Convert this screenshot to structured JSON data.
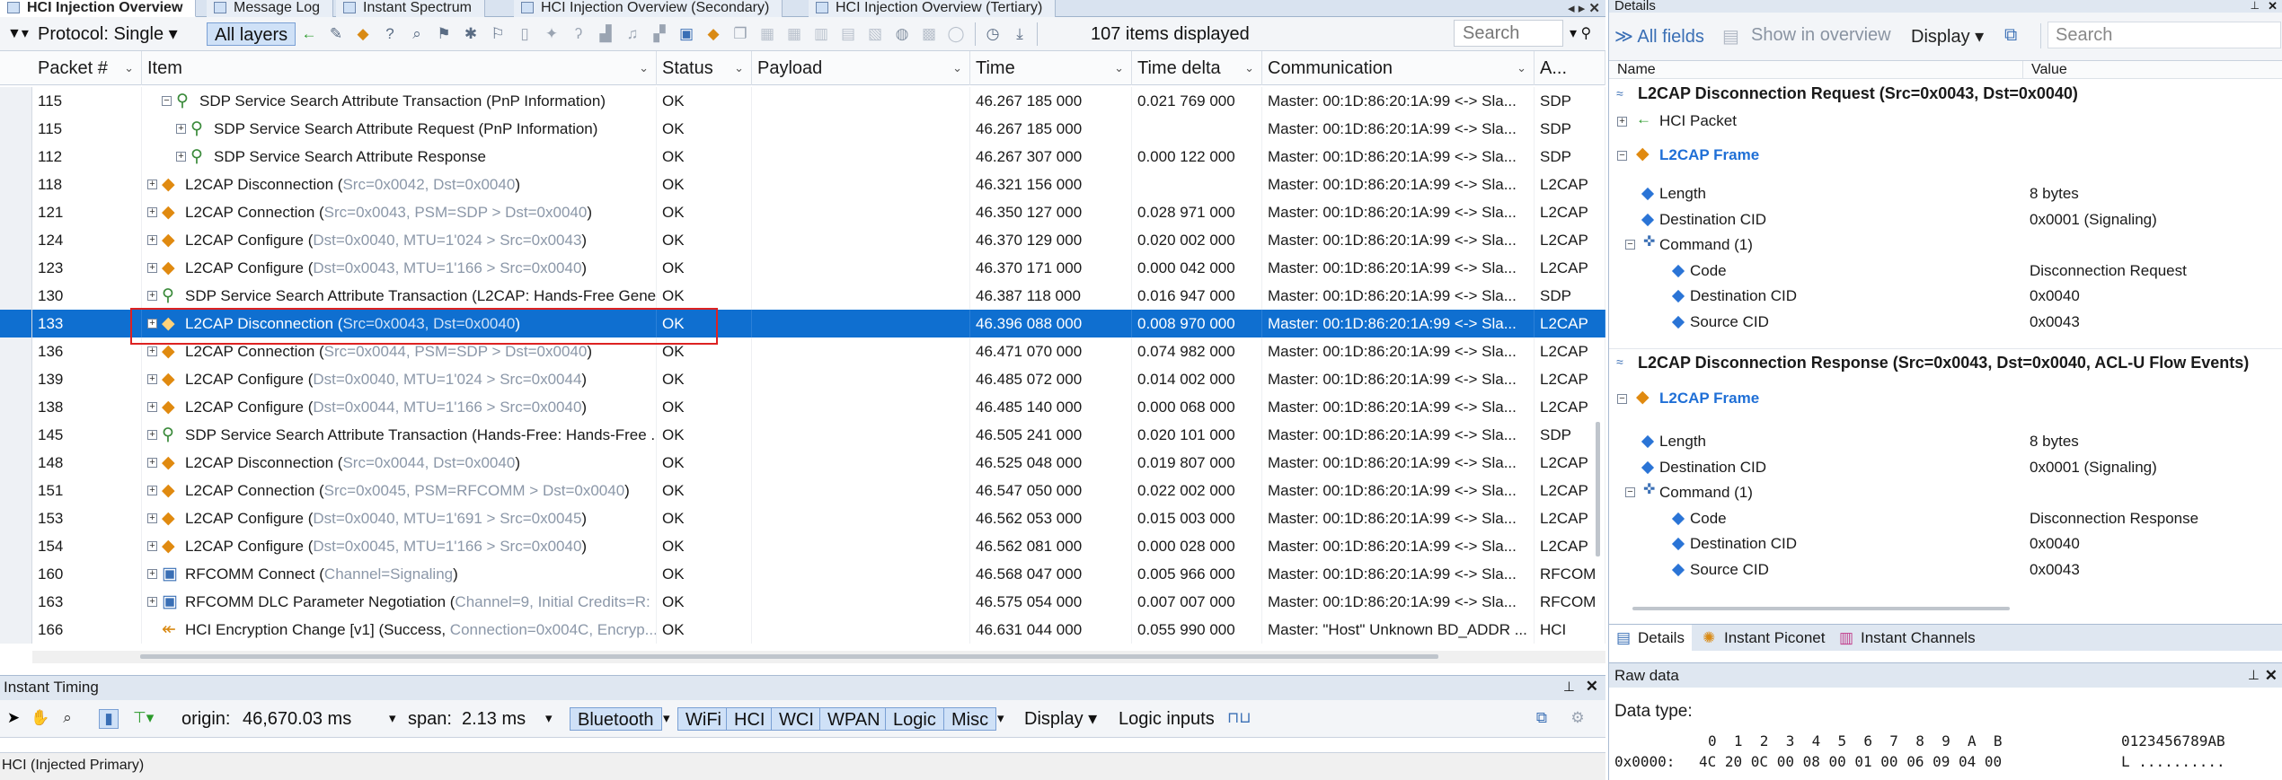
{
  "tabs": [
    {
      "label": "HCI Injection Overview",
      "active": true
    },
    {
      "label": "Message Log",
      "active": false
    },
    {
      "label": "Instant Spectrum",
      "active": false
    },
    {
      "label": "HCI Injection Overview (Secondary)",
      "active": false
    },
    {
      "label": "HCI Injection Overview (Tertiary)",
      "active": false
    }
  ],
  "toolbar": {
    "protocol_label": "Protocol: Single",
    "all_layers": "All layers",
    "items_count": "107 items displayed",
    "search_placeholder": "Search"
  },
  "columns": [
    "Packet #",
    "Item",
    "Status",
    "Payload",
    "Time",
    "Time delta",
    "Communication",
    "A..."
  ],
  "rows": [
    {
      "packet": "115",
      "indent": 1,
      "expand": "−",
      "icon": "sdp",
      "text": "SDP Service Search Attribute Transaction (PnP Information)",
      "status": "OK",
      "time": "46.267 185 000",
      "delta": "0.021 769 000",
      "comm": "Master: 00:1D:86:20:1A:99 <-> Sla...",
      "proto": "SDP"
    },
    {
      "packet": "115",
      "indent": 2,
      "expand": "+",
      "icon": "sdp",
      "text": "SDP Service Search Attribute Request (PnP Information)",
      "status": "OK",
      "time": "46.267 185 000",
      "delta": "",
      "comm": "Master: 00:1D:86:20:1A:99 <-> Sla...",
      "proto": "SDP"
    },
    {
      "packet": "112",
      "indent": 2,
      "expand": "+",
      "icon": "sdp",
      "text": "SDP Service Search Attribute Response",
      "status": "OK",
      "time": "46.267 307 000",
      "delta": "0.000 122 000",
      "comm": "Master: 00:1D:86:20:1A:99 <-> Sla...",
      "proto": "SDP"
    },
    {
      "packet": "118",
      "indent": 0,
      "expand": "+",
      "icon": "l2cap",
      "text": "L2CAP Disconnection (",
      "params": "Src=0x0042, Dst=0x0040",
      "tail": ")",
      "status": "OK",
      "time": "46.321 156 000",
      "delta": "",
      "comm": "Master: 00:1D:86:20:1A:99 <-> Sla...",
      "proto": "L2CAP"
    },
    {
      "packet": "121",
      "indent": 0,
      "expand": "+",
      "icon": "l2cap",
      "text": "L2CAP Connection (",
      "params": "Src=0x0043, PSM=SDP > Dst=0x0040",
      "tail": ")",
      "status": "OK",
      "time": "46.350 127 000",
      "delta": "0.028 971 000",
      "comm": "Master: 00:1D:86:20:1A:99 <-> Sla...",
      "proto": "L2CAP"
    },
    {
      "packet": "124",
      "indent": 0,
      "expand": "+",
      "icon": "l2cap",
      "text": "L2CAP Configure (",
      "params": "Dst=0x0040, MTU=1'024 > Src=0x0043",
      "tail": ")",
      "status": "OK",
      "time": "46.370 129 000",
      "delta": "0.020 002 000",
      "comm": "Master: 00:1D:86:20:1A:99 <-> Sla...",
      "proto": "L2CAP"
    },
    {
      "packet": "123",
      "indent": 0,
      "expand": "+",
      "icon": "l2cap",
      "text": "L2CAP Configure (",
      "params": "Dst=0x0043, MTU=1'166 > Src=0x0040",
      "tail": ")",
      "status": "OK",
      "time": "46.370 171 000",
      "delta": "0.000 042 000",
      "comm": "Master: 00:1D:86:20:1A:99 <-> Sla...",
      "proto": "L2CAP"
    },
    {
      "packet": "130",
      "indent": 0,
      "expand": "+",
      "icon": "sdp",
      "text": "SDP Service Search Attribute Transaction (L2CAP: Hands-Free Gene...",
      "status": "OK",
      "time": "46.387 118 000",
      "delta": "0.016 947 000",
      "comm": "Master: 00:1D:86:20:1A:99 <-> Sla...",
      "proto": "SDP"
    },
    {
      "packet": "133",
      "indent": 0,
      "expand": "+",
      "icon": "l2cap",
      "text": "L2CAP Disconnection (",
      "params": "Src=0x0043, Dst=0x0040",
      "tail": ")",
      "status": "OK",
      "time": "46.396 088 000",
      "delta": "0.008 970 000",
      "comm": "Master: 00:1D:86:20:1A:99 <-> Sla...",
      "proto": "L2CAP",
      "selected": true
    },
    {
      "packet": "136",
      "indent": 0,
      "expand": "+",
      "icon": "l2cap",
      "text": "L2CAP Connection (",
      "params": "Src=0x0044, PSM=SDP > Dst=0x0040",
      "tail": ")",
      "status": "OK",
      "time": "46.471 070 000",
      "delta": "0.074 982 000",
      "comm": "Master: 00:1D:86:20:1A:99 <-> Sla...",
      "proto": "L2CAP"
    },
    {
      "packet": "139",
      "indent": 0,
      "expand": "+",
      "icon": "l2cap",
      "text": "L2CAP Configure (",
      "params": "Dst=0x0040, MTU=1'024 > Src=0x0044",
      "tail": ")",
      "status": "OK",
      "time": "46.485 072 000",
      "delta": "0.014 002 000",
      "comm": "Master: 00:1D:86:20:1A:99 <-> Sla...",
      "proto": "L2CAP"
    },
    {
      "packet": "138",
      "indent": 0,
      "expand": "+",
      "icon": "l2cap",
      "text": "L2CAP Configure (",
      "params": "Dst=0x0044, MTU=1'166 > Src=0x0040",
      "tail": ")",
      "status": "OK",
      "time": "46.485 140 000",
      "delta": "0.000 068 000",
      "comm": "Master: 00:1D:86:20:1A:99 <-> Sla...",
      "proto": "L2CAP"
    },
    {
      "packet": "145",
      "indent": 0,
      "expand": "+",
      "icon": "sdp",
      "text": "SDP Service Search Attribute Transaction (Hands-Free: Hands-Free ...",
      "status": "OK",
      "time": "46.505 241 000",
      "delta": "0.020 101 000",
      "comm": "Master: 00:1D:86:20:1A:99 <-> Sla...",
      "proto": "SDP"
    },
    {
      "packet": "148",
      "indent": 0,
      "expand": "+",
      "icon": "l2cap",
      "text": "L2CAP Disconnection (",
      "params": "Src=0x0044, Dst=0x0040",
      "tail": ")",
      "status": "OK",
      "time": "46.525 048 000",
      "delta": "0.019 807 000",
      "comm": "Master: 00:1D:86:20:1A:99 <-> Sla...",
      "proto": "L2CAP"
    },
    {
      "packet": "151",
      "indent": 0,
      "expand": "+",
      "icon": "l2cap",
      "text": "L2CAP Connection (",
      "params": "Src=0x0045, PSM=RFCOMM > Dst=0x0040",
      "tail": ")",
      "status": "OK",
      "time": "46.547 050 000",
      "delta": "0.022 002 000",
      "comm": "Master: 00:1D:86:20:1A:99 <-> Sla...",
      "proto": "L2CAP"
    },
    {
      "packet": "153",
      "indent": 0,
      "expand": "+",
      "icon": "l2cap",
      "text": "L2CAP Configure (",
      "params": "Dst=0x0040, MTU=1'691 > Src=0x0045",
      "tail": ")",
      "status": "OK",
      "time": "46.562 053 000",
      "delta": "0.015 003 000",
      "comm": "Master: 00:1D:86:20:1A:99 <-> Sla...",
      "proto": "L2CAP"
    },
    {
      "packet": "154",
      "indent": 0,
      "expand": "+",
      "icon": "l2cap",
      "text": "L2CAP Configure (",
      "params": "Dst=0x0045, MTU=1'166 > Src=0x0040",
      "tail": ")",
      "status": "OK",
      "time": "46.562 081 000",
      "delta": "0.000 028 000",
      "comm": "Master: 00:1D:86:20:1A:99 <-> Sla...",
      "proto": "L2CAP"
    },
    {
      "packet": "160",
      "indent": 0,
      "expand": "+",
      "icon": "rfcomm",
      "text": "RFCOMM Connect (",
      "params": "Channel=Signaling",
      "tail": ")",
      "status": "OK",
      "time": "46.568 047 000",
      "delta": "0.005 966 000",
      "comm": "Master: 00:1D:86:20:1A:99 <-> Sla...",
      "proto": "RFCOM"
    },
    {
      "packet": "163",
      "indent": 0,
      "expand": "+",
      "icon": "rfcomm",
      "text": "RFCOMM DLC Parameter Negotiation (",
      "params": "Channel=9, Initial Credits=R: ...",
      "tail": "",
      "status": "OK",
      "time": "46.575 054 000",
      "delta": "0.007 007 000",
      "comm": "Master: 00:1D:86:20:1A:99 <-> Sla...",
      "proto": "RFCOM"
    },
    {
      "packet": "166",
      "indent": 0,
      "expand": "",
      "icon": "hci",
      "text": "HCI Encryption Change [v1] (Success, ",
      "params": "Connection=0x004C, Encryp...",
      "tail": "",
      "status": "OK",
      "time": "46.631 044 000",
      "delta": "0.055 990 000",
      "comm": "Master: \"Host\" Unknown BD_ADDR ...",
      "proto": "HCI"
    }
  ],
  "timing": {
    "title": "Instant Timing",
    "origin_label": "origin:",
    "origin_value": "46,670.03 ms",
    "span_label": "span:",
    "span_value": "2.13 ms",
    "filters": [
      "Bluetooth",
      "WiFi",
      "HCI",
      "WCI",
      "WPAN",
      "Logic",
      "Misc"
    ],
    "display": "Display",
    "logic_inputs": "Logic inputs"
  },
  "status_bar": "HCI (Injected Primary)",
  "details": {
    "title": "Details",
    "all_fields": "All fields",
    "show_in_overview": "Show in overview",
    "display": "Display",
    "search_placeholder": "Search",
    "col_name": "Name",
    "col_value": "Value",
    "section1_title": "L2CAP Disconnection Request (Src=0x0043, Dst=0x0040)",
    "hci_packet": "HCI Packet",
    "frame_label": "L2CAP Frame",
    "s1_fields": [
      {
        "name": "Length",
        "value": "8 bytes",
        "level": 1
      },
      {
        "name": "Destination CID",
        "value": "0x0001 (Signaling)",
        "level": 1
      },
      {
        "name": "Command (1)",
        "value": "",
        "level": 1,
        "group": true
      },
      {
        "name": "Code",
        "value": "Disconnection Request",
        "level": 2
      },
      {
        "name": "Destination CID",
        "value": "0x0040",
        "level": 2
      },
      {
        "name": "Source CID",
        "value": "0x0043",
        "level": 2
      }
    ],
    "section2_title": "L2CAP Disconnection Response (Src=0x0043, Dst=0x0040, ACL-U Flow Events)",
    "s2_fields": [
      {
        "name": "Length",
        "value": "8 bytes",
        "level": 1
      },
      {
        "name": "Destination CID",
        "value": "0x0001 (Signaling)",
        "level": 1
      },
      {
        "name": "Command (1)",
        "value": "",
        "level": 1,
        "group": true
      },
      {
        "name": "Code",
        "value": "Disconnection Response",
        "level": 2
      },
      {
        "name": "Destination CID",
        "value": "0x0040",
        "level": 2
      },
      {
        "name": "Source CID",
        "value": "0x0043",
        "level": 2
      }
    ],
    "bottom_tabs": [
      "Details",
      "Instant Piconet",
      "Instant Channels"
    ]
  },
  "raw": {
    "title": "Raw data",
    "data_type": "Data type:",
    "header_hex": "0  1  2  3  4  5  6  7  8  9  A  B",
    "header_ascii": "0123456789AB",
    "offset": "0x0000:",
    "bytes": "4C 20 0C 00 08 00 01 00 06 09 04 00",
    "ascii": "L .........."
  },
  "colors": {
    "selection": "#0f6fd0",
    "accent_blue": "#1f6fd6",
    "highlight_box": "#dd2222"
  }
}
